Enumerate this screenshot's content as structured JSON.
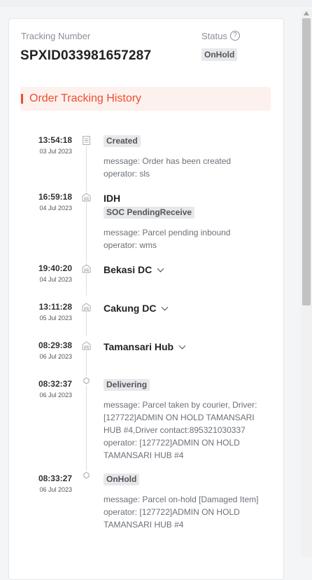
{
  "header": {
    "tracking_label": "Tracking Number",
    "tracking_number": "SPXID033981657287",
    "status_label": "Status",
    "status_value": "OnHold"
  },
  "history": {
    "title": "Order Tracking History",
    "events": [
      {
        "time": "13:54:18",
        "date": "03 Jul 2023",
        "icon": "document-icon",
        "tag": "Created",
        "message": "message: Order has been created",
        "operator": "operator: sls"
      },
      {
        "time": "16:59:18",
        "date": "04 Jul 2023",
        "icon": "warehouse-icon",
        "location": "IDH",
        "tag": "SOC PendingReceive",
        "message": "message: Parcel pending inbound",
        "operator": "operator: wms"
      },
      {
        "time": "19:40:20",
        "date": "04 Jul 2023",
        "icon": "warehouse-icon",
        "location": "Bekasi DC",
        "expandable": true
      },
      {
        "time": "13:11:28",
        "date": "05 Jul 2023",
        "icon": "warehouse-icon",
        "location": "Cakung DC",
        "expandable": true
      },
      {
        "time": "08:29:38",
        "date": "06 Jul 2023",
        "icon": "warehouse-icon",
        "location": "Tamansari Hub",
        "expandable": true
      },
      {
        "time": "08:32:37",
        "date": "06 Jul 2023",
        "icon": "circle-icon",
        "tag": "Delivering",
        "message": "message: Parcel taken by courier, Driver: [127722]ADMIN ON HOLD TAMANSARI HUB #4,Driver contact:895321030337",
        "operator": "operator: [127722]ADMIN ON HOLD TAMANSARI HUB #4"
      },
      {
        "time": "08:33:27",
        "date": "06 Jul 2023",
        "icon": "circle-icon",
        "tag": "OnHold",
        "message": "message: Parcel on-hold [Damaged Item]",
        "operator": "operator: [127722]ADMIN ON HOLD TAMANSARI HUB #4"
      }
    ]
  },
  "colors": {
    "accent": "#ee4d2d",
    "accent_bg": "#fdf1ee",
    "tag_bg": "#e6e8ec"
  }
}
